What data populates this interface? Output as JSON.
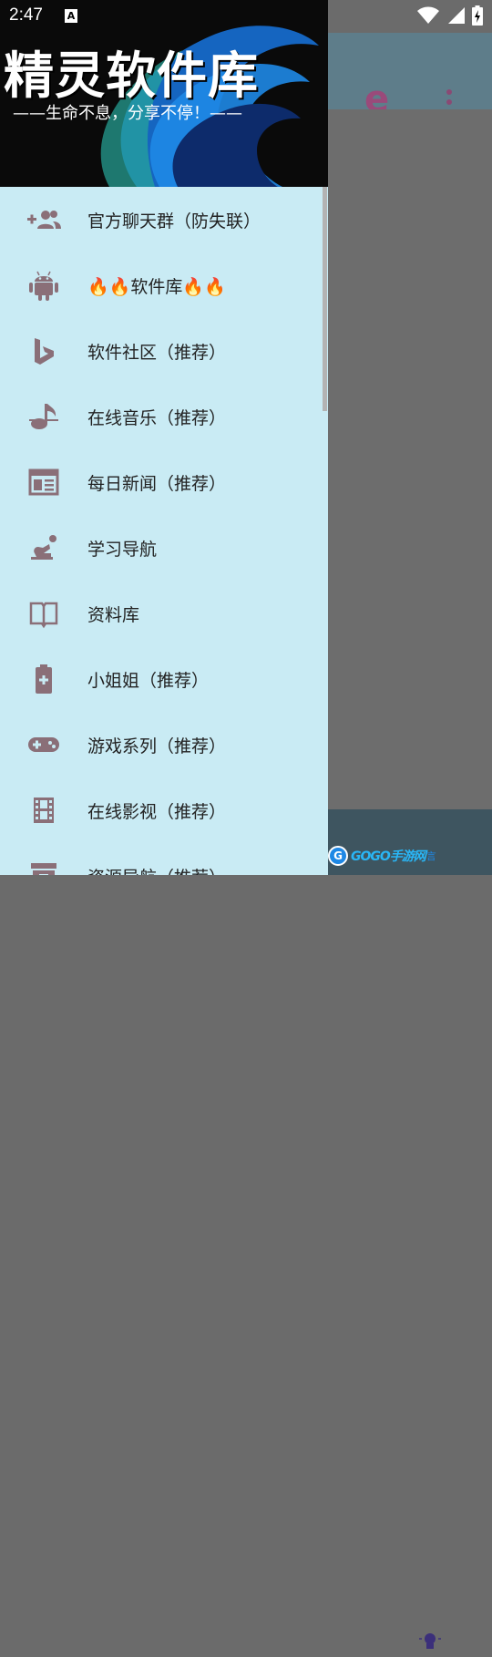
{
  "status_bar": {
    "time": "2:47",
    "notification_badge": "A",
    "icons": [
      "wifi-icon",
      "signal-icon",
      "battery-charging-icon"
    ]
  },
  "background_app": {
    "toolbar_logo": "e",
    "watermark_logo": "G",
    "watermark_text": "GOGO手游网",
    "watermark_suffix": "言"
  },
  "drawer": {
    "header": {
      "title": "精灵软件库",
      "slogan": "——生命不息，分享不停！——"
    },
    "items": [
      {
        "label": "官方聊天群（防失联）",
        "icon": "group-add-icon"
      },
      {
        "label": "🔥🔥软件库🔥🔥",
        "icon": "android-icon"
      },
      {
        "label": "软件社区（推荐）",
        "icon": "bing-icon"
      },
      {
        "label": "在线音乐（推荐）",
        "icon": "music-note-icon"
      },
      {
        "label": "每日新闻（推荐）",
        "icon": "newspaper-icon"
      },
      {
        "label": "学习导航",
        "icon": "study-person-icon"
      },
      {
        "label": "资料库",
        "icon": "book-icon"
      },
      {
        "label": "小姐姐（推荐）",
        "icon": "battery-plus-icon"
      },
      {
        "label": "游戏系列（推荐）",
        "icon": "gamepad-icon"
      },
      {
        "label": "在线影视（推荐）",
        "icon": "film-icon"
      },
      {
        "label": "资源导航（推荐）",
        "icon": "archive-icon"
      }
    ]
  },
  "colors": {
    "drawer_bg": "#c9ebf4",
    "icon": "#8a6f78",
    "scrim": "#6b6b6b"
  }
}
